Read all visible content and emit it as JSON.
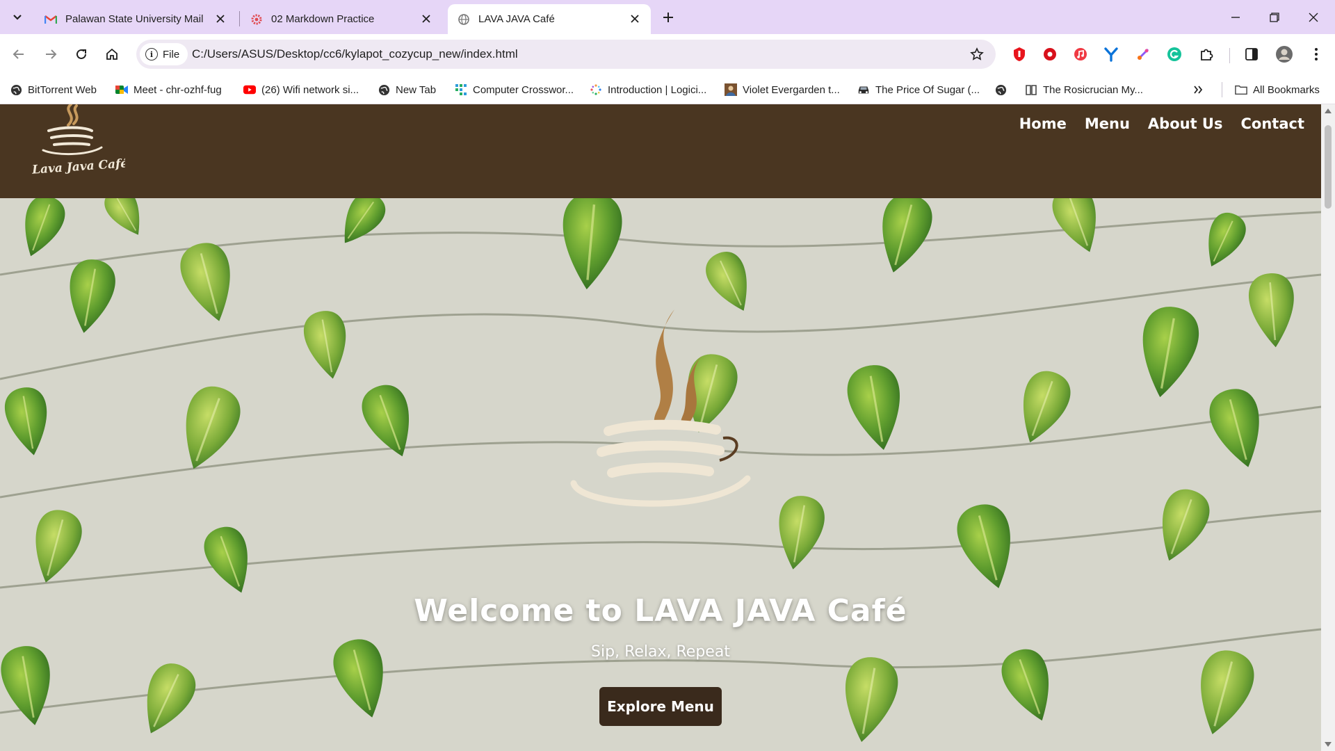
{
  "browser": {
    "tabs": [
      {
        "title": "Palawan State University Mail",
        "icon": "gmail-icon",
        "active": false
      },
      {
        "title": "02 Markdown Practice",
        "icon": "gear-icon",
        "active": false
      },
      {
        "title": "LAVA JAVA Café",
        "icon": "globe-icon",
        "active": true
      }
    ],
    "address": {
      "scheme_label": "File",
      "url": "C:/Users/ASUS/Desktop/cc6/kylapot_cozycup_new/index.html"
    },
    "bookmarks": [
      {
        "label": "BitTorrent Web",
        "icon": "globe-icon"
      },
      {
        "label": "Meet - chr-ozhf-fug",
        "icon": "meet-icon"
      },
      {
        "label": "(26) Wifi network si...",
        "icon": "youtube-icon"
      },
      {
        "label": "New Tab",
        "icon": "globe-icon"
      },
      {
        "label": "Computer Crosswor...",
        "icon": "grid-icon"
      },
      {
        "label": "Introduction | Logici...",
        "icon": "sparkle-icon"
      },
      {
        "label": "Violet Evergarden t...",
        "icon": "image-icon"
      },
      {
        "label": "The Price Of Sugar (...",
        "icon": "car-icon"
      },
      {
        "label": "",
        "icon": "globe-icon"
      },
      {
        "label": "The Rosicrucian My...",
        "icon": "book-icon"
      }
    ],
    "all_bookmarks_label": "All Bookmarks"
  },
  "site": {
    "logo_text": "Lava Java Café",
    "nav": [
      "Home",
      "Menu",
      "About Us",
      "Contact"
    ],
    "hero": {
      "title": "Welcome to LAVA JAVA Café",
      "subtitle": "Sip, Relax, Repeat",
      "button": "Explore Menu"
    }
  },
  "colors": {
    "tabstrip": "#e6d6f7",
    "header": "#4a3621",
    "button": "#3a2a1c",
    "cup_steam": "#b07f45",
    "cup_body": "#efe6d4"
  }
}
